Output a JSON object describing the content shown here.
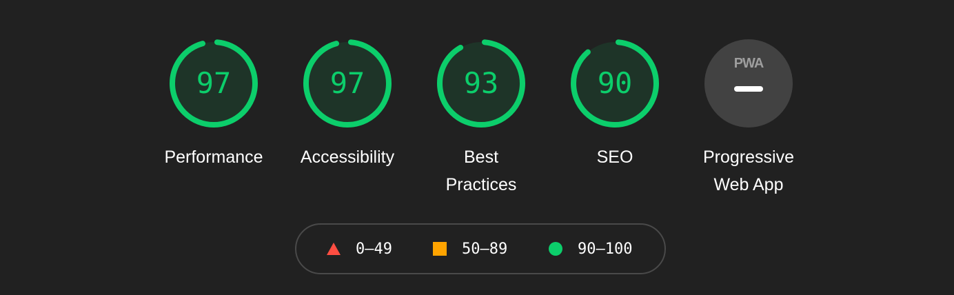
{
  "colors": {
    "background": "#212121",
    "pass": "#0cce6b",
    "average": "#ffa400",
    "fail": "#ff4e42",
    "pass_fill": "#1e3428",
    "pwa_fill": "#424242"
  },
  "gauges": [
    {
      "score": "97",
      "score_fraction": 0.97,
      "label": "Performance"
    },
    {
      "score": "97",
      "score_fraction": 0.97,
      "label": "Accessibility"
    },
    {
      "score": "93",
      "score_fraction": 0.93,
      "label": "Best\nPractices"
    },
    {
      "score": "90",
      "score_fraction": 0.9,
      "label": "SEO"
    }
  ],
  "pwa": {
    "badge_text": "PWA",
    "label": "Progressive\nWeb App",
    "icon": "pwa-dash-icon"
  },
  "legend": [
    {
      "icon": "triangle-icon",
      "range": "0–49"
    },
    {
      "icon": "square-icon",
      "range": "50–89"
    },
    {
      "icon": "circle-icon",
      "range": "90–100"
    }
  ]
}
